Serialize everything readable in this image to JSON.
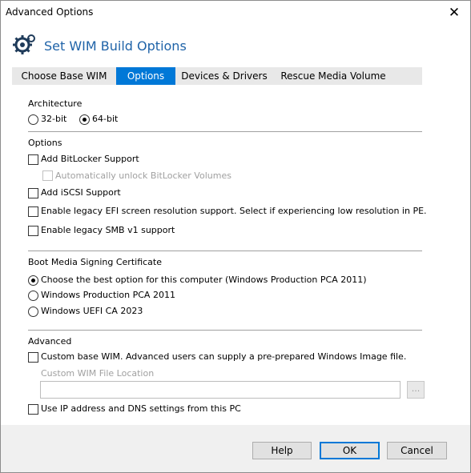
{
  "window": {
    "title": "Advanced Options"
  },
  "header": {
    "title": "Set WIM Build Options"
  },
  "tabs": [
    {
      "label": "Choose Base WIM",
      "active": false
    },
    {
      "label": "Options",
      "active": true
    },
    {
      "label": "Devices & Drivers",
      "active": false
    },
    {
      "label": "Rescue Media Volume",
      "active": false
    }
  ],
  "architecture": {
    "label": "Architecture",
    "options": [
      {
        "label": "32-bit",
        "selected": false
      },
      {
        "label": "64-bit",
        "selected": true
      }
    ]
  },
  "options": {
    "label": "Options",
    "items": [
      {
        "label": "Add BitLocker Support",
        "checked": false,
        "enabled": true
      },
      {
        "label": "Automatically unlock BitLocker Volumes",
        "checked": false,
        "enabled": false
      },
      {
        "label": "Add iSCSI Support",
        "checked": false,
        "enabled": true
      },
      {
        "label": "Enable legacy EFI screen resolution support. Select if experiencing low resolution in PE.",
        "checked": false,
        "enabled": true
      },
      {
        "label": "Enable legacy SMB v1 support",
        "checked": false,
        "enabled": true
      }
    ]
  },
  "signing": {
    "label": "Boot Media Signing Certificate",
    "options": [
      {
        "label": "Choose the best option for this computer (Windows Production PCA 2011)",
        "selected": true
      },
      {
        "label": "Windows Production PCA 2011",
        "selected": false
      },
      {
        "label": "Windows UEFI CA 2023",
        "selected": false
      }
    ]
  },
  "advanced": {
    "label": "Advanced",
    "custom_wim_label": "Custom base WIM. Advanced users can supply a pre-prepared Windows Image file.",
    "custom_wim_location_label": "Custom WIM File Location",
    "custom_wim_location_value": "",
    "browse_label": "...",
    "use_ip_label": "Use IP address and DNS settings from this PC"
  },
  "buttons": {
    "help": "Help",
    "ok": "OK",
    "cancel": "Cancel"
  },
  "colors": {
    "accent": "#0078d7",
    "title_blue": "#1f63a8"
  }
}
